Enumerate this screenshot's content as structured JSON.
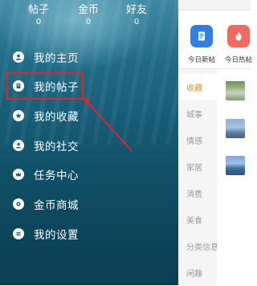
{
  "drawer": {
    "stats": [
      {
        "label": "帖子",
        "value": "0"
      },
      {
        "label": "金币",
        "value": "0"
      },
      {
        "label": "好友",
        "value": "0"
      }
    ],
    "menu": [
      {
        "label": "我的主页",
        "icon": "user-icon"
      },
      {
        "label": "我的帖子",
        "icon": "document-icon"
      },
      {
        "label": "我的收藏",
        "icon": "star-icon"
      },
      {
        "label": "我的社交",
        "icon": "friends-icon"
      },
      {
        "label": "任务中心",
        "icon": "crown-icon"
      },
      {
        "label": "金币商城",
        "icon": "coin-icon"
      },
      {
        "label": "我的设置",
        "icon": "settings-icon"
      }
    ]
  },
  "content": {
    "quick": [
      {
        "label": "今日新帖",
        "icon": "new-post-icon",
        "color": "#2f7fe6"
      },
      {
        "label": "今日热帖",
        "icon": "fire-icon",
        "color": "#f06a5e"
      }
    ],
    "categories": [
      "收藏",
      "城事",
      "情感",
      "家居",
      "消费",
      "美食",
      "分类信息",
      "闲趣"
    ],
    "active_category": "收藏"
  },
  "colors": {
    "highlight": "#e0262a",
    "accent": "#f08b1b"
  }
}
